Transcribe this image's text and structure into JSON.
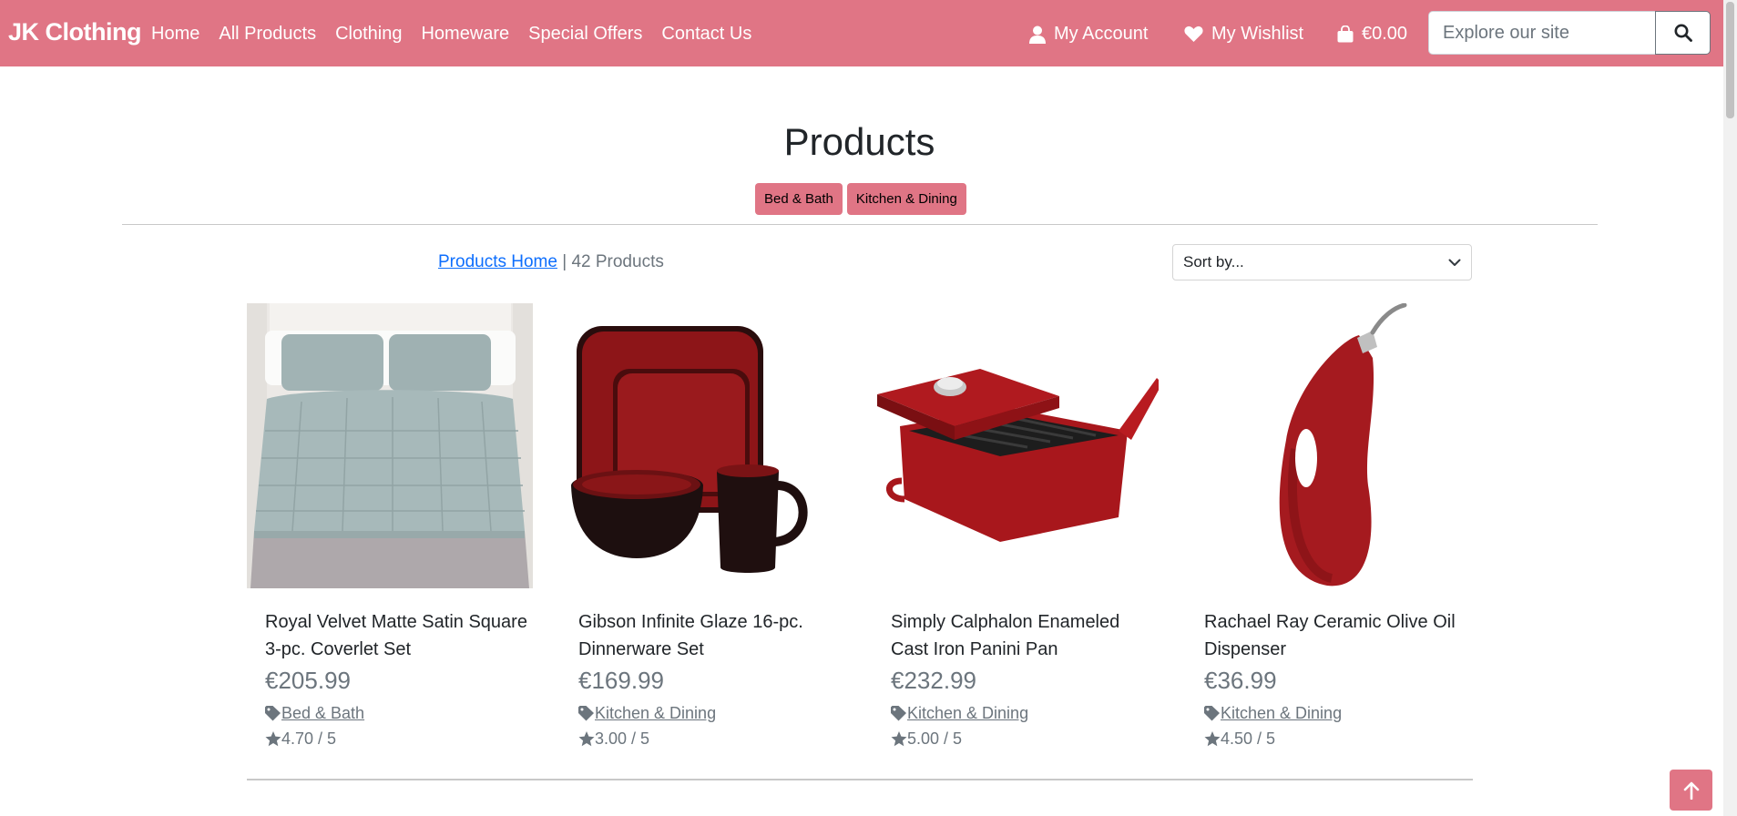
{
  "navbar": {
    "brand": "JK Clothing",
    "links": [
      "Home",
      "All Products",
      "Clothing",
      "Homeware",
      "Special Offers",
      "Contact Us"
    ],
    "account_label": "My Account",
    "wishlist_label": "My Wishlist",
    "cart_total": "€0.00",
    "search_placeholder": "Explore our site",
    "icons": {
      "account": "user-icon",
      "wishlist": "heart-icon",
      "cart": "shopping-bag-icon",
      "search": "search-icon"
    },
    "colors": {
      "background": "#e07585",
      "text": "#ffffff"
    }
  },
  "page": {
    "title": "Products",
    "category_badges": [
      "Bed & Bath",
      "Kitchen & Dining"
    ],
    "breadcrumb_link": "Products Home",
    "separator": "|",
    "product_count": "42 Products",
    "sort_placeholder": "Sort by..."
  },
  "products": [
    {
      "name": "Royal Velvet Matte Satin Square 3-pc. Coverlet Set",
      "price": "€205.99",
      "category": "Bed & Bath",
      "rating": "4.70 / 5",
      "image": "grey-coverlet-bed-image"
    },
    {
      "name": "Gibson Infinite Glaze 16-pc. Dinnerware Set",
      "price": "€169.99",
      "category": "Kitchen & Dining",
      "rating": "3.00 / 5",
      "image": "red-dinnerware-set-image"
    },
    {
      "name": "Simply Calphalon Enameled Cast Iron Panini Pan",
      "price": "€232.99",
      "category": "Kitchen & Dining",
      "rating": "5.00 / 5",
      "image": "red-panini-pan-image"
    },
    {
      "name": "Rachael Ray Ceramic Olive Oil Dispenser",
      "price": "€36.99",
      "category": "Kitchen & Dining",
      "rating": "4.50 / 5",
      "image": "red-oil-dispenser-image"
    }
  ],
  "icons": {
    "tag": "tag-icon",
    "star": "star-icon",
    "chevron": "chevron-down-icon",
    "back_to_top": "arrow-up-icon"
  }
}
